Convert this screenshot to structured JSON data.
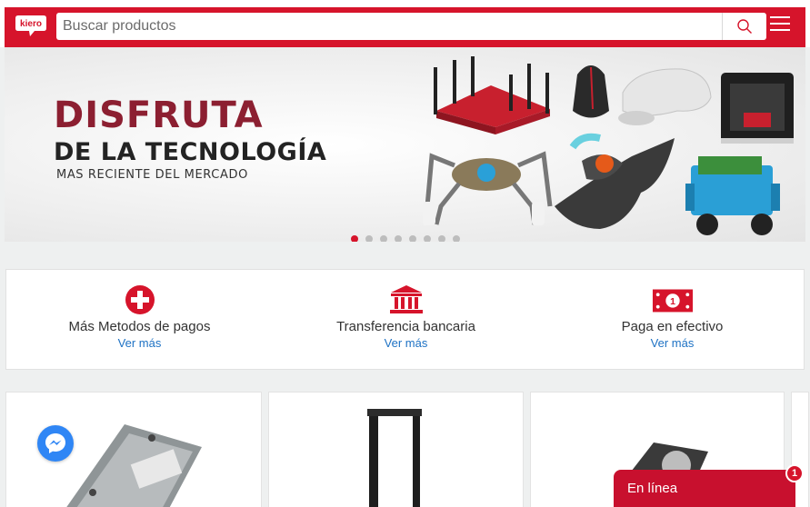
{
  "header": {
    "logo_text": "kiero",
    "search": {
      "placeholder": "Buscar productos",
      "value": ""
    },
    "menu_icon": "hamburger-icon",
    "search_icon": "search-icon",
    "brand_color": "#d6142b"
  },
  "banner": {
    "title_line1": "DISFRUTA",
    "title_line2": "DE LA TECNOLOGÍA",
    "title_line3": "MAS RECIENTE DEL MERCADO",
    "slides_count": 8,
    "active_slide": 1
  },
  "payments": [
    {
      "icon": "plus-circle-icon",
      "label": "Más Metodos de pagos",
      "link": "Ver más"
    },
    {
      "icon": "bank-icon",
      "label": "Transferencia bancaria",
      "link": "Ver más"
    },
    {
      "icon": "cash-icon",
      "label": "Paga en efectivo",
      "link": "Ver más"
    }
  ],
  "products": [
    {
      "icon": "hard-drive-icon"
    },
    {
      "icon": "server-rack-icon"
    },
    {
      "icon": "hard-drive-icon"
    }
  ],
  "messenger_icon": "messenger-icon",
  "chat": {
    "label": "En línea",
    "badge": "1"
  }
}
